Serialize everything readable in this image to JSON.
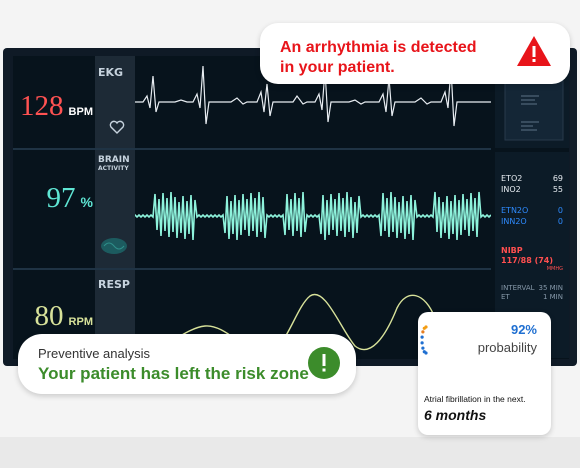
{
  "vitals": {
    "heart_rate": {
      "value": "128",
      "unit": "BPM",
      "color": "#ff5252"
    },
    "brain": {
      "value": "97",
      "unit": "%",
      "color": "#5fe6d4"
    },
    "resp": {
      "value": "80",
      "unit": "RPM",
      "color": "#d8e29a"
    }
  },
  "channels": {
    "ekg": "EKG",
    "brain_line1": "BRAIN",
    "brain_line2": "ACTIVITY",
    "resp": "RESP"
  },
  "side_panel": {
    "eto2_label": "ETO2",
    "eto2_value": "69",
    "ino2_label": "INO2",
    "ino2_value": "55",
    "etn2o_label": "ETN2O",
    "etn2o_value": "0",
    "inn2o_label": "INN2O",
    "inn2o_value": "0",
    "nibp_label": "NIBP",
    "nibp_value": "117/88",
    "nibp_mean": "(74)",
    "nibp_unit": "MMHG",
    "interval_label": "INTERVAL",
    "interval_value": "35 MIN",
    "et_label": "ET",
    "et_value": "1 MIN"
  },
  "alert": {
    "line1": "An arrhythmia is detected",
    "line2": "in your patient.",
    "icon": "warning-triangle-icon",
    "color": "#e8141a"
  },
  "analysis": {
    "caption": "Preventive analysis",
    "title": "Your patient has left the risk zone",
    "icon": "exclamation-circle-icon",
    "color": "#3c8c2b"
  },
  "probability": {
    "percent": "92%",
    "label": "probability",
    "description": "Atrial fibrillation in the next.",
    "period": "6 months",
    "accent": "#1f6fd1"
  }
}
